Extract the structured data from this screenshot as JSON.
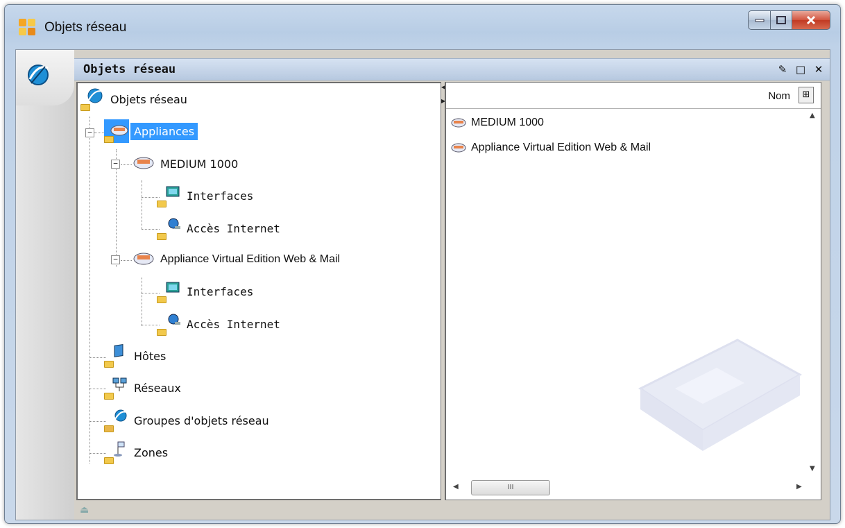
{
  "window": {
    "title": "Objets réseau",
    "minimize_icon": "minimize-icon",
    "maximize_icon": "maximize-icon",
    "close_icon": "close-icon",
    "close_color": "#c13a23"
  },
  "panel": {
    "title": "Objets réseau",
    "pin_icon": "pin-icon",
    "maximize_icon": "maximize-icon",
    "close_icon": "close-icon"
  },
  "tree": {
    "root": "Objets réseau",
    "appliances": "Appliances",
    "medium": "MEDIUM 1000",
    "medium_interfaces": "Interfaces",
    "medium_internet": "Accès Internet",
    "vedition": "Appliance Virtual Edition Web & Mail",
    "vedition_interfaces": "Interfaces",
    "vedition_internet": "Accès Internet",
    "hosts": "Hôtes",
    "networks": "Réseaux",
    "groups": "Groupes d'objets réseau",
    "zones": "Zones",
    "selected_color": "#3399ff"
  },
  "list": {
    "column_name": "Nom",
    "items": [
      "MEDIUM 1000",
      "Appliance Virtual Edition Web & Mail"
    ],
    "hscroll_thumb": "III"
  }
}
